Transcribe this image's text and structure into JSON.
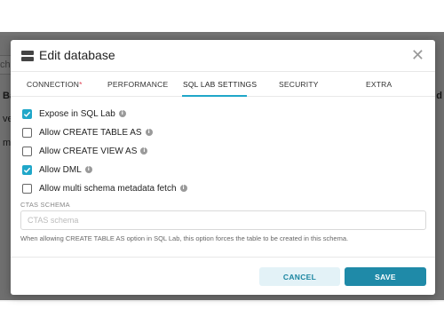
{
  "background": {
    "search_fragment": "ch",
    "row_header": "Ba",
    "row_1": "ve",
    "row_2": "my",
    "col_fragment": "d"
  },
  "modal": {
    "title": "Edit database",
    "tabs": [
      {
        "label": "CONNECTION",
        "required_mark": "*"
      },
      {
        "label": "PERFORMANCE"
      },
      {
        "label": "SQL LAB SETTINGS",
        "active": true
      },
      {
        "label": "SECURITY"
      },
      {
        "label": "EXTRA"
      }
    ],
    "options": [
      {
        "label": "Expose in SQL Lab",
        "checked": true
      },
      {
        "label": "Allow CREATE TABLE AS",
        "checked": false
      },
      {
        "label": "Allow CREATE VIEW AS",
        "checked": false
      },
      {
        "label": "Allow DML",
        "checked": true
      },
      {
        "label": "Allow multi schema metadata fetch",
        "checked": false
      }
    ],
    "info_glyph": "i",
    "ctas": {
      "label": "CTAS SCHEMA",
      "placeholder": "CTAS schema",
      "value": "",
      "help": "When allowing CREATE TABLE AS option in SQL Lab, this option forces the table to be created in this schema."
    },
    "buttons": {
      "cancel": "CANCEL",
      "save": "SAVE"
    },
    "close_glyph": "✕"
  },
  "colors": {
    "accent": "#20a7c9",
    "primary_button": "#1f8aa8",
    "secondary_button_bg": "#e3f2f7",
    "required": "#e04355"
  }
}
